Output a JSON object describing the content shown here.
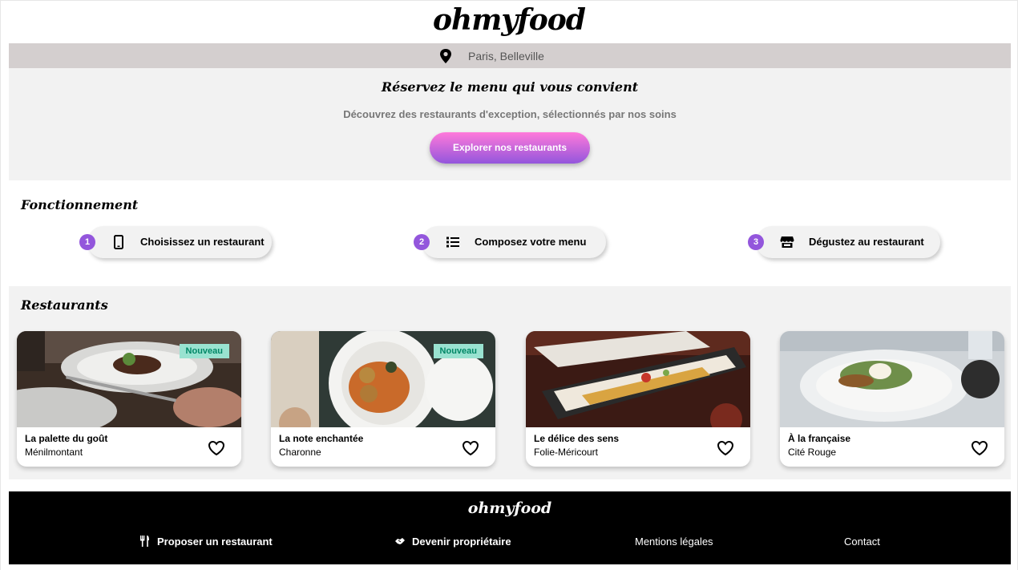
{
  "header": {
    "logo": "ohmyfood"
  },
  "location": {
    "icon": "map-pin-icon",
    "text": "Paris, Belleville"
  },
  "hero": {
    "title": "Réservez le menu qui vous convient",
    "subtitle": "Découvrez des restaurants d'exception, sélectionnés par nos soins",
    "cta_label": "Explorer nos restaurants"
  },
  "steps": {
    "title": "Fonctionnement",
    "items": [
      {
        "number": "1",
        "icon": "mobile-phone-icon",
        "label": "Choisissez un restaurant"
      },
      {
        "number": "2",
        "icon": "list-icon",
        "label": "Composez votre menu"
      },
      {
        "number": "3",
        "icon": "store-icon",
        "label": "Dégustez au restaurant"
      }
    ]
  },
  "restaurants": {
    "title": "Restaurants",
    "cards": [
      {
        "name": "La palette du goût",
        "area": "Ménilmontant",
        "badge": "Nouveau",
        "icon": "heart-icon"
      },
      {
        "name": "La note enchantée",
        "area": "Charonne",
        "badge": "Nouveau",
        "icon": "heart-icon"
      },
      {
        "name": "Le délice des sens",
        "area": "Folie-Méricourt",
        "badge": "",
        "icon": "heart-icon"
      },
      {
        "name": "À la française",
        "area": "Cité Rouge",
        "badge": "",
        "icon": "heart-icon"
      }
    ]
  },
  "footer": {
    "logo": "ohmyfood",
    "links": [
      {
        "label": "Proposer un restaurant",
        "icon": "utensils-icon"
      },
      {
        "label": "Devenir propriétaire",
        "icon": "handshake-icon"
      },
      {
        "label": "Mentions légales"
      },
      {
        "label": "Contact"
      }
    ]
  },
  "colors": {
    "accent_purple": "#9356dc",
    "accent_pink": "#ff79da",
    "badge_bg": "#99e2d0",
    "badge_text": "#008766"
  }
}
